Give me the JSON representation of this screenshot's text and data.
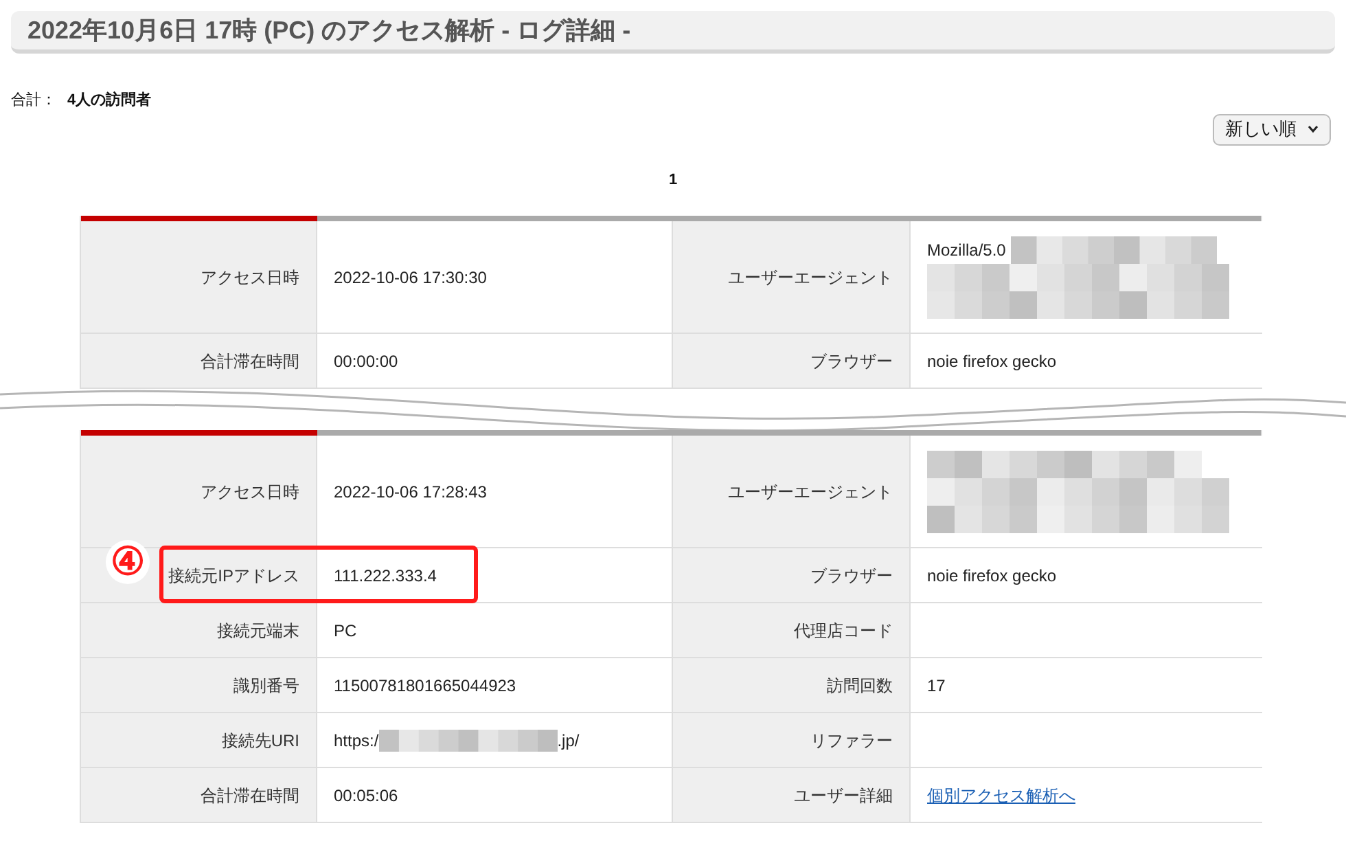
{
  "page_title": "2022年10月6日 17時 (PC) のアクセス解析 - ログ詳細 -",
  "summary": {
    "label": "合計：",
    "value": "4人の訪問者"
  },
  "sort_select": {
    "value": "新しい順"
  },
  "pagination": [
    {
      "label": "1",
      "selected": true
    }
  ],
  "records": [
    {
      "left_rows": [
        {
          "label": "アクセス日時",
          "kind": "text",
          "value": "2022-10-06 17:30:30"
        },
        {
          "label": "合計滞在時間",
          "kind": "text",
          "value": "00:00:00"
        }
      ],
      "right_rows": [
        {
          "label": "ユーザーエージェント",
          "kind": "masked",
          "prefix": "Mozilla/5.0"
        },
        {
          "label": "ブラウザー",
          "kind": "text",
          "value": "noie firefox gecko"
        }
      ]
    },
    {
      "left_rows": [
        {
          "label": "アクセス日時",
          "kind": "text",
          "value": "2022-10-06 17:28:43"
        },
        {
          "label": "接続元IPアドレス",
          "kind": "text",
          "value": "111.222.333.4",
          "annotation": "④"
        },
        {
          "label": "接続元端末",
          "kind": "text",
          "value": "PC"
        },
        {
          "label": "識別番号",
          "kind": "text",
          "value": "11500781801665044923"
        },
        {
          "label": "接続先URI",
          "kind": "masked_url",
          "prefix": "https:/",
          "suffix": ".jp/"
        },
        {
          "label": "合計滞在時間",
          "kind": "text",
          "value": "00:05:06"
        }
      ],
      "right_rows": [
        {
          "label": "ユーザーエージェント",
          "kind": "masked"
        },
        {
          "label": "ブラウザー",
          "kind": "text",
          "value": "noie firefox gecko"
        },
        {
          "label": "代理店コード",
          "kind": "text"
        },
        {
          "label": "訪問回数",
          "kind": "text",
          "value": "17"
        },
        {
          "label": "リファラー",
          "kind": "text"
        },
        {
          "label": "ユーザー詳細",
          "kind": "link",
          "value": "個別アクセス解析へ"
        }
      ]
    }
  ]
}
